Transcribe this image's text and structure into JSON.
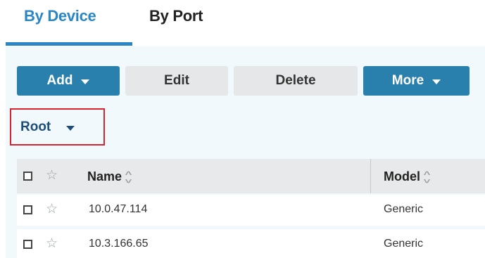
{
  "tabs": [
    {
      "label": "By Device",
      "active": true
    },
    {
      "label": "By Port",
      "active": false
    }
  ],
  "toolbar": {
    "add_label": "Add",
    "edit_label": "Edit",
    "delete_label": "Delete",
    "more_label": "More"
  },
  "group_selector": {
    "value": "Root"
  },
  "table": {
    "columns": [
      "Name",
      "Model"
    ],
    "rows": [
      {
        "name": "10.0.47.114",
        "model": "Generic"
      },
      {
        "name": "10.3.166.65",
        "model": "Generic"
      }
    ]
  },
  "colors": {
    "accent": "#2a86c4",
    "primary_button": "#2a80ad",
    "highlight_border": "#d9242f"
  }
}
